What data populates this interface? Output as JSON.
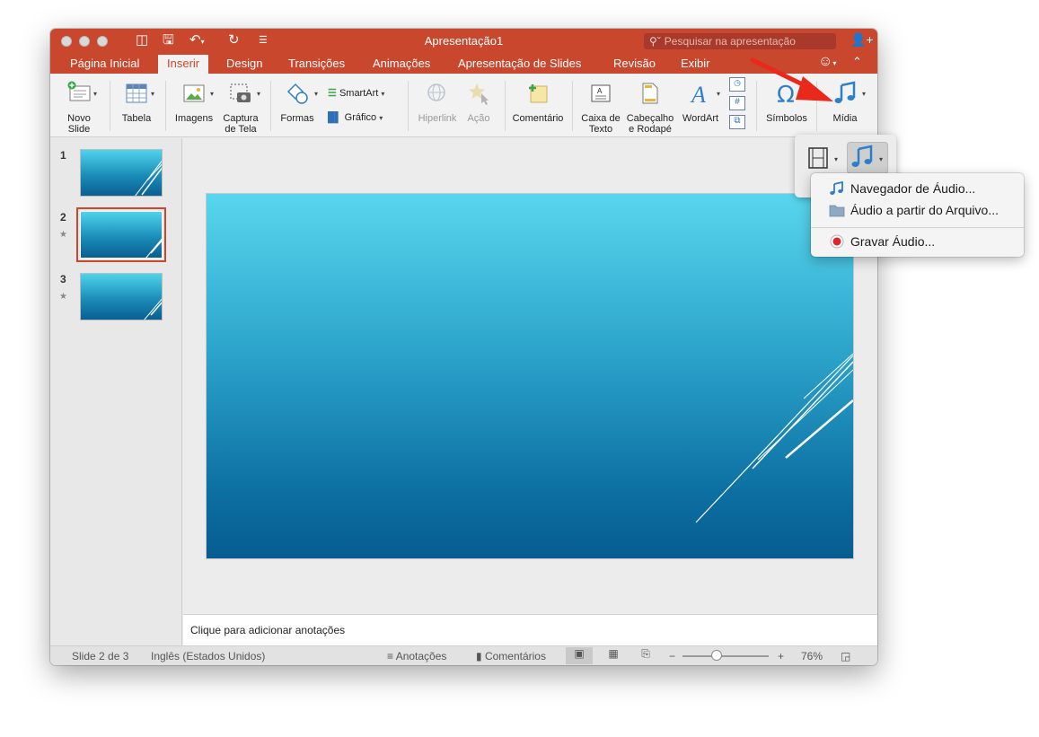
{
  "window": {
    "title": "Apresentação1"
  },
  "search": {
    "placeholder": "Pesquisar na apresentação"
  },
  "tabs": [
    {
      "label": "Página Inicial",
      "active": false
    },
    {
      "label": "Inserir",
      "active": true
    },
    {
      "label": "Design",
      "active": false
    },
    {
      "label": "Transições",
      "active": false
    },
    {
      "label": "Animações",
      "active": false
    },
    {
      "label": "Apresentação de Slides",
      "active": false
    },
    {
      "label": "Revisão",
      "active": false
    },
    {
      "label": "Exibir",
      "active": false
    }
  ],
  "ribbon": {
    "novo_slide": "Novo Slide",
    "tabela": "Tabela",
    "imagens": "Imagens",
    "captura": "Captura de Tela",
    "formas": "Formas",
    "smartart": "SmartArt",
    "grafico": "Gráfico",
    "hiperlink": "Hiperlink",
    "acao": "Ação",
    "comentario": "Comentário",
    "caixa_texto": "Caixa de Texto",
    "cabecalho": "Cabeçalho e Rodapé",
    "wordart": "WordArt",
    "simbolos": "Símbolos",
    "midia": "Mídia"
  },
  "thumbnails": [
    {
      "number": "1",
      "starred": false,
      "selected": false
    },
    {
      "number": "2",
      "starred": true,
      "selected": true
    },
    {
      "number": "3",
      "starred": true,
      "selected": false
    }
  ],
  "notes": {
    "placeholder": "Clique para adicionar anotações"
  },
  "status": {
    "slide": "Slide 2 de 3",
    "language": "Inglês (Estados Unidos)",
    "notes": "Anotações",
    "comments": "Comentários",
    "zoom": "76%",
    "zoom_minus": "−",
    "zoom_plus": "+"
  },
  "media_menu": {
    "items": [
      {
        "label": "Navegador de Áudio...",
        "icon": "music-note-icon"
      },
      {
        "label": "Áudio a partir do Arquivo...",
        "icon": "folder-icon"
      },
      {
        "label": "Gravar Áudio...",
        "icon": "record-icon"
      }
    ]
  },
  "colors": {
    "accent": "#c8472d",
    "slide_top": "#59d6ee",
    "slide_bottom": "#075c90",
    "annotation_arrow": "#e8291c"
  }
}
